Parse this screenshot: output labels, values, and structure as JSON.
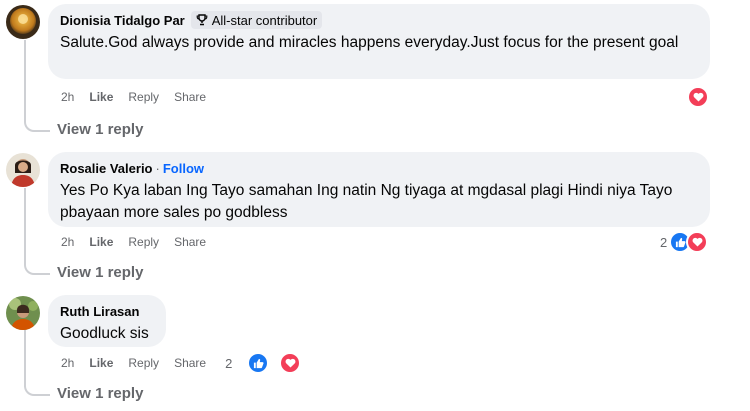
{
  "comments": [
    {
      "author": "Dionisia Tidalgo Par",
      "badge": "All-star contributor",
      "text": "Salute.God always provide and miracles happens everyday.Just focus for the present goal",
      "time": "2h",
      "like_label": "Like",
      "reply_label": "Reply",
      "share_label": "Share",
      "reactions": [
        "love"
      ],
      "view_replies": "View 1 reply"
    },
    {
      "author": "Rosalie Valerio",
      "separator": "·",
      "follow_label": "Follow",
      "text": "Yes Po Kya laban Ing Tayo samahan Ing natin Ng tiyaga at mgdasal plagi Hindi niya Tayo pbayaan more sales po godbless",
      "time": "2h",
      "like_label": "Like",
      "reply_label": "Reply",
      "share_label": "Share",
      "reaction_count": "2",
      "reactions": [
        "like",
        "love"
      ],
      "view_replies": "View 1 reply"
    },
    {
      "author": "Ruth Lirasan",
      "text": "Goodluck sis",
      "time": "2h",
      "like_label": "Like",
      "reply_label": "Reply",
      "share_label": "Share",
      "reaction_count": "2",
      "reactions": [
        "like",
        "love"
      ],
      "view_replies": "View 1 reply"
    }
  ],
  "colors": {
    "bubble": "#f0f2f5",
    "like": "#1877f2",
    "love": "#f33e58",
    "follow": "#0866ff",
    "muted": "#65676b"
  }
}
